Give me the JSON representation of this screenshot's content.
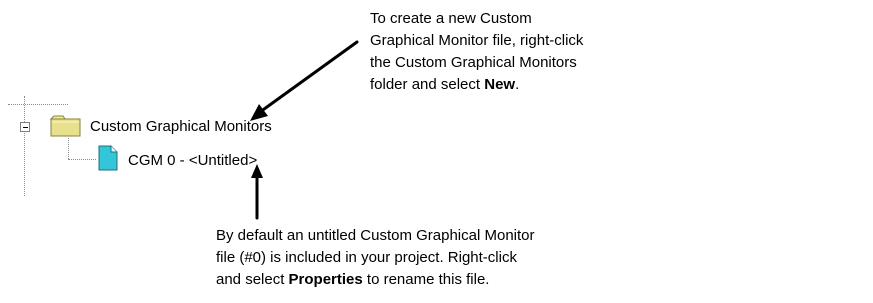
{
  "tree": {
    "folder": {
      "label": "Custom Graphical Monitors",
      "icon": "folder-icon",
      "expanded": true
    },
    "file": {
      "label": "CGM 0 - <Untitled>",
      "icon": "document-icon"
    }
  },
  "annotations": {
    "top": {
      "line1": "To create a new Custom",
      "line2": "Graphical Monitor file, right-click",
      "line3": "the Custom Graphical Monitors",
      "line4_pre": "folder and select ",
      "line4_bold": "New",
      "line4_post": "."
    },
    "bottom": {
      "line1": "By default an untitled Custom Graphical Monitor",
      "line2": "file (#0) is included in your project. Right-click",
      "line3_pre": "and select ",
      "line3_bold": "Properties",
      "line3_post": " to rename this file."
    }
  },
  "colors": {
    "folder_fill": "#e8e08c",
    "folder_tab": "#f0ec9c",
    "document_fill": "#33c6d8",
    "tree_lines": "#8c8c8c"
  }
}
